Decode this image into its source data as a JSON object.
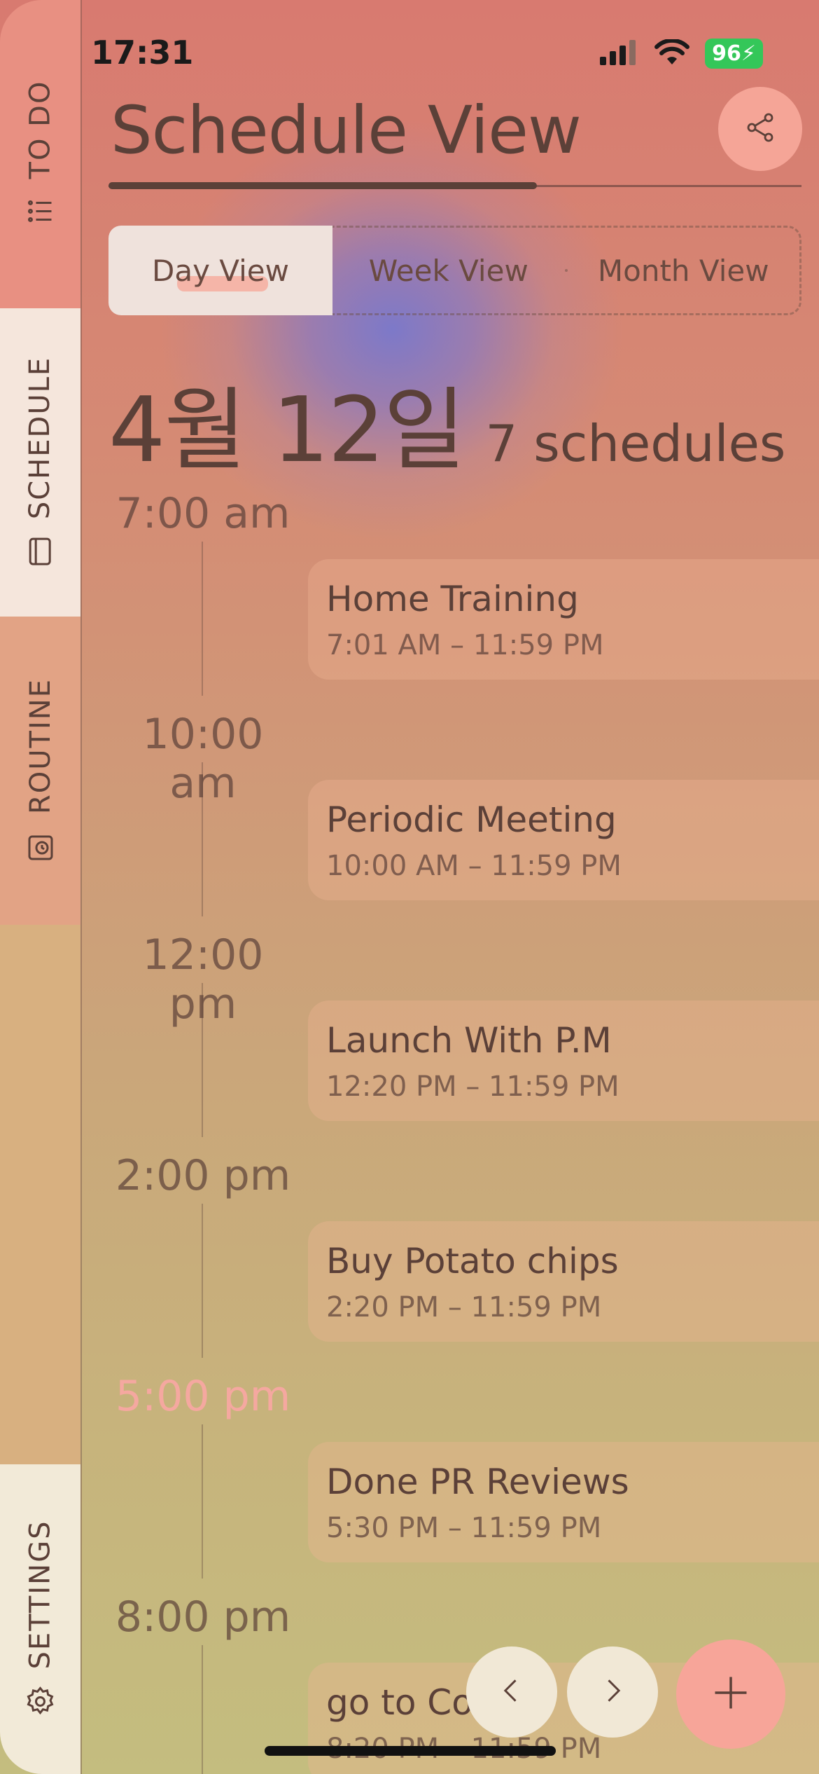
{
  "status_bar": {
    "time": "17:31",
    "battery": "96"
  },
  "sidebar": {
    "tabs": [
      {
        "label": "TO DO",
        "icon": "list-icon"
      },
      {
        "label": "SCHEDULE",
        "icon": "notebook-icon"
      },
      {
        "label": "ROUTINE",
        "icon": "alarm-icon"
      },
      {
        "label": "SETTINGS",
        "icon": "gear-icon"
      }
    ]
  },
  "header": {
    "title": "Schedule View"
  },
  "view_switcher": {
    "options": [
      "Day View",
      "Week View",
      "Month View"
    ],
    "selected": "Day View"
  },
  "date": {
    "heading": "4월 12일",
    "count": "7 schedules"
  },
  "timeline": [
    {
      "time": "7:00 am",
      "title": "Home Training",
      "range": "7:01 AM – 11:59 PM"
    },
    {
      "time": "10:00 am",
      "title": "Periodic Meeting",
      "range": "10:00 AM – 11:59 PM"
    },
    {
      "time": "12:00 pm",
      "title": "Launch With P.M",
      "range": "12:20 PM – 11:59 PM"
    },
    {
      "time": "2:00 pm",
      "title": "Buy Potato chips",
      "range": "2:20 PM – 11:59 PM"
    },
    {
      "time": "5:00 pm",
      "title": "Done PR Reviews",
      "range": "5:30 PM – 11:59 PM",
      "current": true
    },
    {
      "time": "8:00 pm",
      "title": "go to Costco",
      "range": "8:20 PM – 11:59 PM"
    }
  ],
  "colors": {
    "accent": "#f7a599",
    "current_time": "#f5a8a0",
    "text": "#5b4038"
  }
}
